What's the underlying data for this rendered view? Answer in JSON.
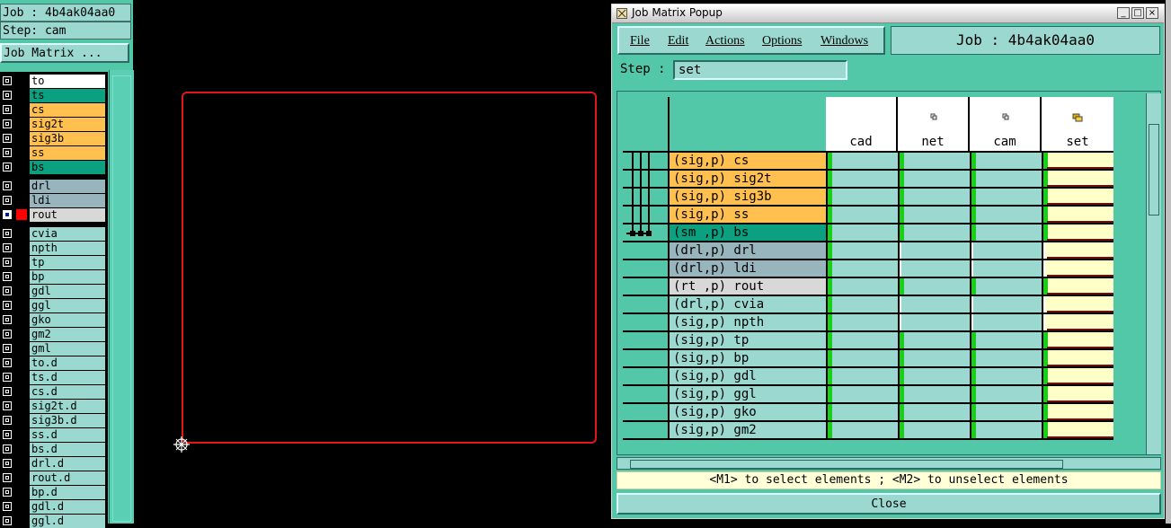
{
  "left_panel": {
    "job_label": "Job : 4b4ak04aa0",
    "step_label": "Step: cam",
    "job_matrix_button": "Job Matrix ...",
    "layers": [
      {
        "name": "to",
        "color": "#ffffff"
      },
      {
        "name": "ts",
        "color": "#0aa080"
      },
      {
        "name": "cs",
        "color": "#ffc050"
      },
      {
        "name": "sig2t",
        "color": "#ffc050"
      },
      {
        "name": "sig3b",
        "color": "#ffc050"
      },
      {
        "name": "ss",
        "color": "#ffc050"
      },
      {
        "name": "bs",
        "color": "#0aa080"
      },
      {
        "name": "drl",
        "color": "#98b4bc"
      },
      {
        "name": "ldi",
        "color": "#98b4bc"
      },
      {
        "name": "rout",
        "color": "#d8d8d8",
        "active": true
      },
      {
        "name": "cvia",
        "color": "#9ad8d0"
      },
      {
        "name": "npth",
        "color": "#9ad8d0"
      },
      {
        "name": "tp",
        "color": "#9ad8d0"
      },
      {
        "name": "bp",
        "color": "#9ad8d0"
      },
      {
        "name": "gdl",
        "color": "#9ad8d0"
      },
      {
        "name": "ggl",
        "color": "#9ad8d0"
      },
      {
        "name": "gko",
        "color": "#9ad8d0"
      },
      {
        "name": "gm2",
        "color": "#9ad8d0"
      },
      {
        "name": "gml",
        "color": "#9ad8d0"
      },
      {
        "name": "to.d",
        "color": "#9ad8d0"
      },
      {
        "name": "ts.d",
        "color": "#9ad8d0"
      },
      {
        "name": "cs.d",
        "color": "#9ad8d0"
      },
      {
        "name": "sig2t.d",
        "color": "#9ad8d0"
      },
      {
        "name": "sig3b.d",
        "color": "#9ad8d0"
      },
      {
        "name": "ss.d",
        "color": "#9ad8d0"
      },
      {
        "name": "bs.d",
        "color": "#9ad8d0"
      },
      {
        "name": "drl.d",
        "color": "#9ad8d0"
      },
      {
        "name": "rout.d",
        "color": "#9ad8d0"
      },
      {
        "name": "bp.d",
        "color": "#9ad8d0"
      },
      {
        "name": "gdl.d",
        "color": "#9ad8d0"
      },
      {
        "name": "ggl.d",
        "color": "#9ad8d0"
      }
    ]
  },
  "popup": {
    "title": "Job Matrix Popup",
    "window_buttons": {
      "minimize": "_",
      "maximize": "□",
      "close": "×"
    },
    "menu": [
      "File",
      "Edit",
      "Actions",
      "Options",
      "Windows"
    ],
    "job_title": "Job : 4b4ak04aa0",
    "step_label": "Step :",
    "step_value": "set",
    "columns": [
      "cad",
      "net",
      "cam",
      "set"
    ],
    "rows": [
      {
        "label": "(sig,p) cs",
        "color": "#ffc050"
      },
      {
        "label": "(sig,p) sig2t",
        "color": "#ffc050"
      },
      {
        "label": "(sig,p) sig3b",
        "color": "#ffc050"
      },
      {
        "label": "(sig,p) ss",
        "color": "#ffc050"
      },
      {
        "label": "(sm ,p) bs",
        "color": "#0aa080"
      },
      {
        "label": "(drl,p) drl",
        "color": "#98b4bc"
      },
      {
        "label": "(drl,p) ldi",
        "color": "#98b4bc"
      },
      {
        "label": "(rt ,p) rout",
        "color": "#d8d8d8"
      },
      {
        "label": "(drl,p) cvia",
        "color": "#9ad8d0"
      },
      {
        "label": "(sig,p) npth",
        "color": "#9ad8d0"
      },
      {
        "label": "(sig,p) tp",
        "color": "#9ad8d0"
      },
      {
        "label": "(sig,p) bp",
        "color": "#9ad8d0"
      },
      {
        "label": "(sig,p) gdl",
        "color": "#9ad8d0"
      },
      {
        "label": "(sig,p) ggl",
        "color": "#9ad8d0"
      },
      {
        "label": "(sig,p) gko",
        "color": "#9ad8d0"
      },
      {
        "label": "(sig,p) gm2",
        "color": "#9ad8d0"
      }
    ],
    "hint": "<M1> to select elements ; <M2> to unselect elements",
    "close_button": "Close"
  },
  "colors": {
    "accent": "#52c8a8",
    "board_outline": "#e01818",
    "populated_cell": "#18d018"
  }
}
